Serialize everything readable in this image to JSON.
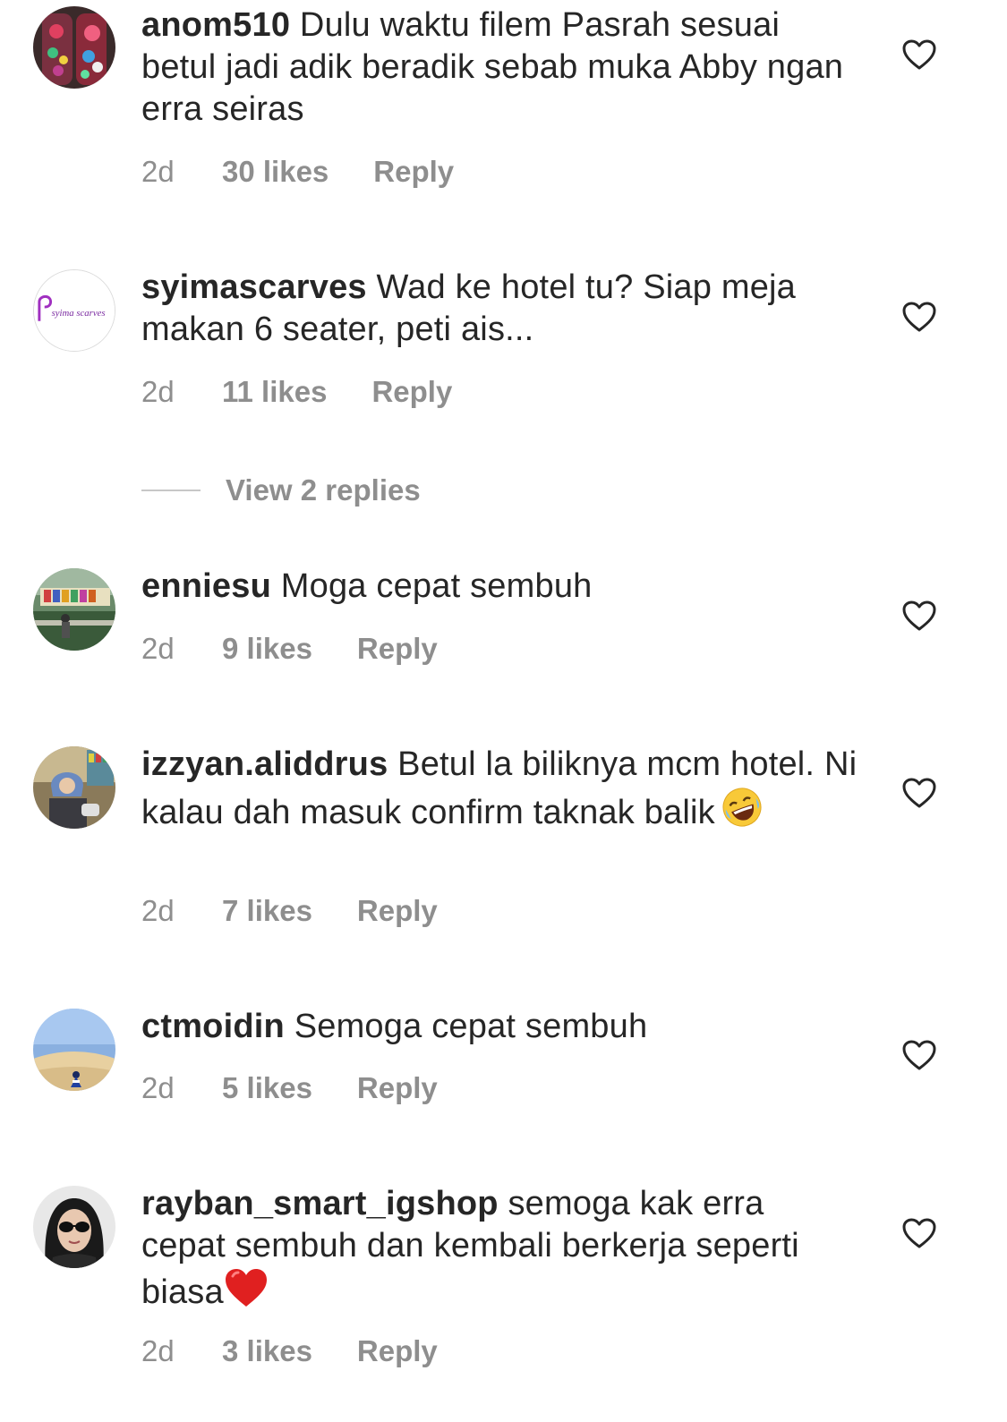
{
  "comments": [
    {
      "username": "anom510",
      "text": "Dulu waktu filem Pasrah sesuai betul jadi adik beradik sebab muka Abby ngan erra seiras",
      "age": "2d",
      "likes": "30 likes",
      "reply": "Reply"
    },
    {
      "username": "syimascarves",
      "text": "Wad ke hotel tu? Siap meja makan 6 seater, peti ais...",
      "age": "2d",
      "likes": "11 likes",
      "reply": "Reply",
      "avatar_text": "syima scarves"
    },
    {
      "username": "enniesu",
      "text": "Moga cepat sembuh",
      "age": "2d",
      "likes": "9 likes",
      "reply": "Reply"
    },
    {
      "username": "izzyan.aliddrus",
      "text": "Betul la biliknya mcm hotel. Ni kalau dah masuk confirm taknak balik",
      "age": "2d",
      "likes": "7 likes",
      "reply": "Reply",
      "emoji": "rolling-on-floor-laughing"
    },
    {
      "username": "ctmoidin",
      "text": "Semoga cepat sembuh",
      "age": "2d",
      "likes": "5 likes",
      "reply": "Reply"
    },
    {
      "username": "rayban_smart_igshop",
      "text": "semoga kak erra cepat sembuh dan kembali berkerja seperti biasa",
      "age": "2d",
      "likes": "3 likes",
      "reply": "Reply",
      "emoji": "red-heart"
    }
  ],
  "view_replies": "View 2 replies",
  "colors": {
    "text": "#262626",
    "meta": "#8e8e8e",
    "divider": "#c7c7c7"
  }
}
